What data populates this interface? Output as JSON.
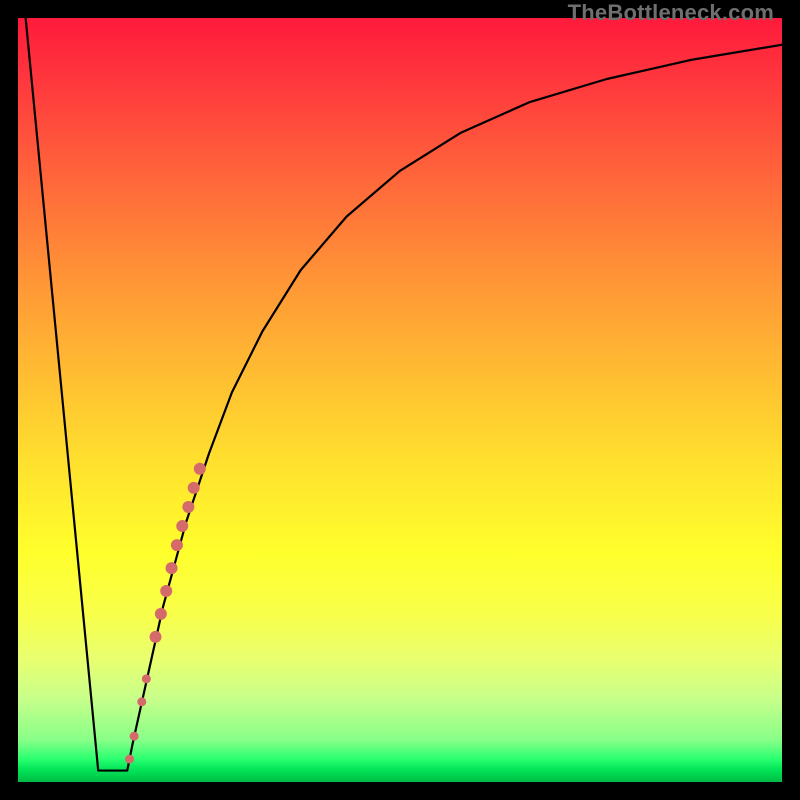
{
  "watermark_text": "TheBottleneck.com",
  "chart_data": {
    "type": "line",
    "title": "",
    "xlabel": "",
    "ylabel": "",
    "xlim": [
      0,
      100
    ],
    "ylim": [
      0,
      100
    ],
    "series": [
      {
        "name": "curve-left-descent",
        "x": [
          1,
          10.5
        ],
        "values": [
          100,
          1.5
        ]
      },
      {
        "name": "curve-valley-floor",
        "x": [
          10.5,
          14.3
        ],
        "values": [
          1.5,
          1.5
        ]
      },
      {
        "name": "curve-right-rise",
        "x": [
          14.3,
          15.0,
          17.0,
          19.0,
          22.0,
          25.0,
          28.0,
          32.0,
          37.0,
          43.0,
          50.0,
          58.0,
          67.0,
          77.0,
          88.0,
          100.0
        ],
        "values": [
          1.5,
          5.0,
          14.0,
          23.0,
          34.0,
          43.0,
          51.0,
          59.0,
          67.0,
          74.0,
          80.0,
          85.0,
          89.0,
          92.0,
          94.5,
          96.5
        ]
      }
    ],
    "highlight_points": {
      "name": "marker-run",
      "color": "#d46a6a",
      "points": [
        {
          "x": 14.6,
          "y": 3.0,
          "r": 4.5
        },
        {
          "x": 15.2,
          "y": 6.0,
          "r": 4.5
        },
        {
          "x": 16.2,
          "y": 10.5,
          "r": 4.5
        },
        {
          "x": 16.8,
          "y": 13.5,
          "r": 4.5
        },
        {
          "x": 18.0,
          "y": 19.0,
          "r": 6.0
        },
        {
          "x": 18.7,
          "y": 22.0,
          "r": 6.0
        },
        {
          "x": 19.4,
          "y": 25.0,
          "r": 6.0
        },
        {
          "x": 20.1,
          "y": 28.0,
          "r": 6.0
        },
        {
          "x": 20.8,
          "y": 31.0,
          "r": 6.0
        },
        {
          "x": 21.5,
          "y": 33.5,
          "r": 6.0
        },
        {
          "x": 22.3,
          "y": 36.0,
          "r": 6.0
        },
        {
          "x": 23.0,
          "y": 38.5,
          "r": 6.0
        },
        {
          "x": 23.8,
          "y": 41.0,
          "r": 6.0
        }
      ]
    }
  }
}
